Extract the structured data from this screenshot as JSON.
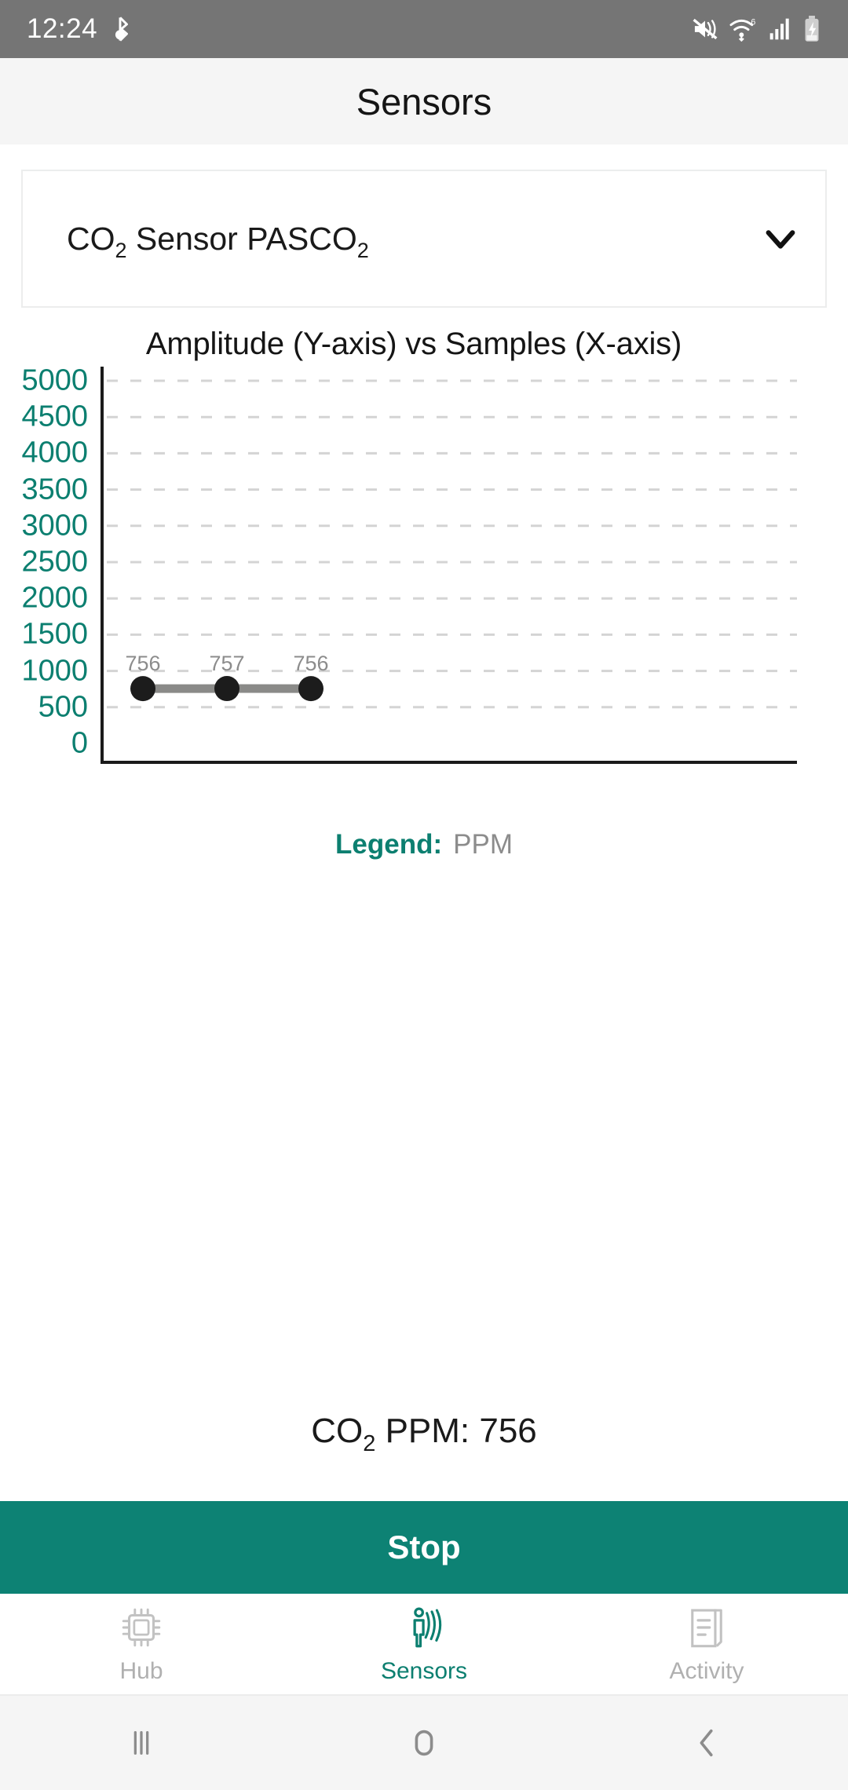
{
  "statusbar": {
    "time": "12:24",
    "left_icons": [
      "bluetooth-audio-icon"
    ],
    "right_icons": [
      "mute-icon",
      "wifi6-icon",
      "cellular-signal-icon",
      "battery-charging-icon"
    ]
  },
  "header": {
    "title": "Sensors"
  },
  "sensor_select": {
    "label_main": "CO",
    "label_sub1": "2",
    "label_mid": " Sensor PASCO",
    "label_sub2": "2",
    "full_label": "CO2 Sensor PASCO2",
    "icon": "chevron-down-icon"
  },
  "chart_data": {
    "type": "line",
    "title": "Amplitude (Y-axis) vs Samples (X-axis)",
    "xlabel": "Samples (X-axis)",
    "ylabel": "Amplitude (Y-axis)",
    "x": [
      1,
      2,
      3
    ],
    "values": [
      756,
      757,
      756
    ],
    "point_labels": [
      "756",
      "757",
      "756"
    ],
    "series": [
      {
        "name": "PPM",
        "values": [
          756,
          757,
          756
        ]
      }
    ],
    "yticks": [
      5000,
      4500,
      4000,
      3500,
      3000,
      2500,
      2000,
      1500,
      1000,
      500,
      0
    ],
    "ylim": [
      0,
      5000
    ],
    "xticks": [],
    "grid": true,
    "grid_style": "dashed-horizontal",
    "legend_position": "below",
    "colors": {
      "tick_label": "#0c7f70",
      "grid": "#d4d4d4",
      "axis": "#1a1a1a",
      "line": "#8a8a88",
      "point": "#1c1c1c",
      "point_label": "#8c8c8c"
    }
  },
  "legend": {
    "key": "Legend:",
    "value": "PPM"
  },
  "readout": {
    "prefix": "CO",
    "sub": "2",
    "suffix": " PPM: 756",
    "full": "CO2 PPM: 756",
    "value": 756,
    "unit": "PPM"
  },
  "action_button": {
    "label": "Stop",
    "color": "#0d8274"
  },
  "bottom_nav": {
    "items": [
      {
        "label": "Hub",
        "icon": "chip-icon",
        "active": false
      },
      {
        "label": "Sensors",
        "icon": "motion-sensor-icon",
        "active": true
      },
      {
        "label": "Activity",
        "icon": "document-list-icon",
        "active": false
      }
    ],
    "active_color": "#0c7f70",
    "inactive_color": "#b0b0b0"
  },
  "android_nav": {
    "items": [
      {
        "name": "recents-button",
        "icon": "recents-icon"
      },
      {
        "name": "home-button",
        "icon": "home-icon"
      },
      {
        "name": "back-button",
        "icon": "back-icon"
      }
    ]
  }
}
